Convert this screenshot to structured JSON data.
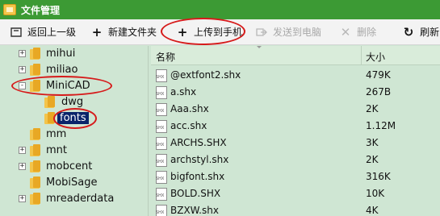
{
  "window": {
    "title": "文件管理"
  },
  "toolbar": {
    "back_label": "返回上一级",
    "new_folder_label": "新建文件夹",
    "upload_label": "上传到手机",
    "send_label": "发送到电脑",
    "delete_label": "删除",
    "refresh_label": "刷新"
  },
  "tree": {
    "items": [
      {
        "label": "mihui",
        "expander": "+"
      },
      {
        "label": "miliao",
        "expander": "+"
      },
      {
        "label": "MiniCAD",
        "expander": "-"
      },
      {
        "label": "dwg",
        "expander": ""
      },
      {
        "label": "fonts",
        "expander": ""
      },
      {
        "label": "mm",
        "expander": ""
      },
      {
        "label": "mnt",
        "expander": "+"
      },
      {
        "label": "mobcent",
        "expander": "+"
      },
      {
        "label": "MobiSage",
        "expander": ""
      },
      {
        "label": "mreaderdata",
        "expander": "+"
      }
    ],
    "selected": "fonts"
  },
  "files": {
    "columns": {
      "name": "名称",
      "size": "大小"
    },
    "rows": [
      {
        "name": "@extfont2.shx",
        "size": "479K"
      },
      {
        "name": "a.shx",
        "size": "267B"
      },
      {
        "name": "Aaa.shx",
        "size": "2K"
      },
      {
        "name": "acc.shx",
        "size": "1.12M"
      },
      {
        "name": "ARCHS.SHX",
        "size": "3K"
      },
      {
        "name": "archstyl.shx",
        "size": "2K"
      },
      {
        "name": "bigfont.shx",
        "size": "316K"
      },
      {
        "name": "BOLD.SHX",
        "size": "10K"
      },
      {
        "name": "BZXW.shx",
        "size": "4K"
      }
    ]
  },
  "colors": {
    "title_bar": "#3c9a34",
    "pane_background": "#cfe6d3",
    "highlight_ring": "#d61a1a",
    "selection": "#0a246a"
  }
}
